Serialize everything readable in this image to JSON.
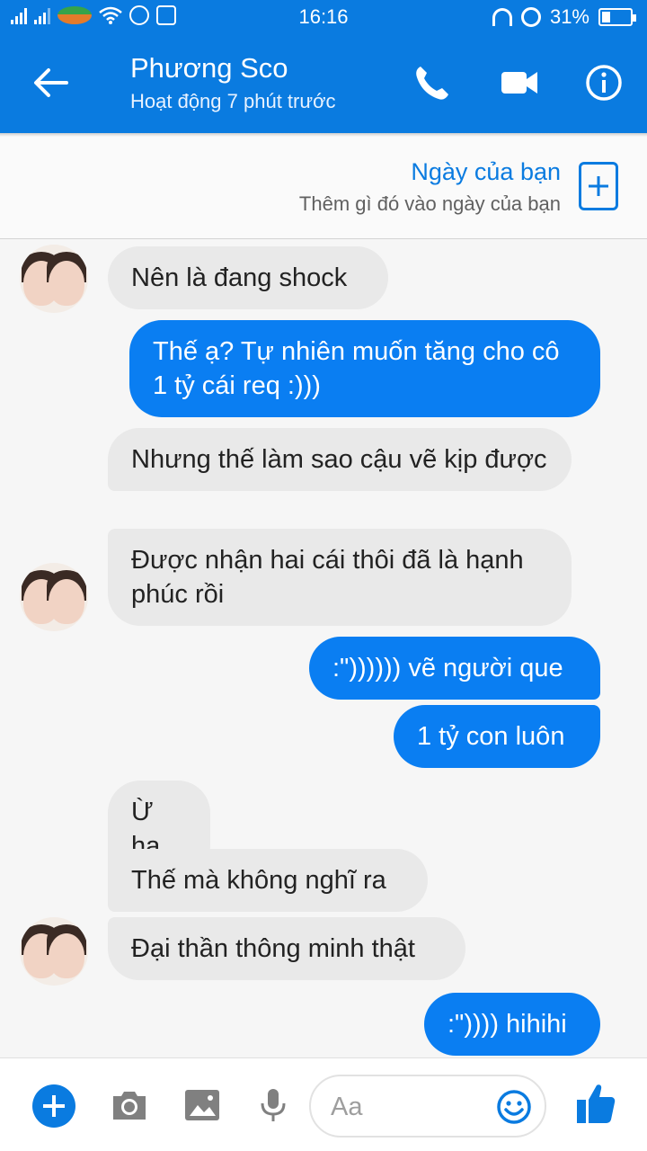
{
  "status_bar": {
    "time": "16:16",
    "battery": "31%",
    "battery_level": 0.31
  },
  "header": {
    "title": "Phương Sco",
    "subtitle": "Hoạt động 7 phút trước"
  },
  "day_card": {
    "title": "Ngày của bạn",
    "subtitle": "Thêm gì đó vào ngày của bạn"
  },
  "messages": [
    {
      "from": "them",
      "text": "Nên là đang shock"
    },
    {
      "from": "me",
      "text": "Thế ạ? Tự nhiên muốn tăng cho cô 1 tỷ cái req :)))"
    },
    {
      "from": "them",
      "text": "Nhưng thế làm sao cậu vẽ kịp được"
    },
    {
      "from": "them",
      "text": "Được nhận hai cái thôi đã là hạnh phúc rồi"
    },
    {
      "from": "me",
      "text": ":\")))))) vẽ người que"
    },
    {
      "from": "me",
      "text": "1 tỷ con luôn"
    },
    {
      "from": "them",
      "text": "Ừ ha"
    },
    {
      "from": "them",
      "text": "Thế mà không nghĩ ra"
    },
    {
      "from": "them",
      "text": "Đại thần thông minh thật"
    },
    {
      "from": "me",
      "text": ":\")))) hihihi"
    }
  ],
  "composer": {
    "placeholder": "Aa"
  },
  "colors": {
    "brand": "#0a7be0",
    "outgoing_bubble": "#0a7ef2",
    "incoming_bubble": "#e9e9e9"
  },
  "icons": [
    "back-arrow-icon",
    "phone-icon",
    "video-camera-icon",
    "info-icon",
    "plus-icon",
    "camera-icon",
    "image-icon",
    "microphone-icon",
    "smile-icon",
    "thumbs-up-icon"
  ]
}
